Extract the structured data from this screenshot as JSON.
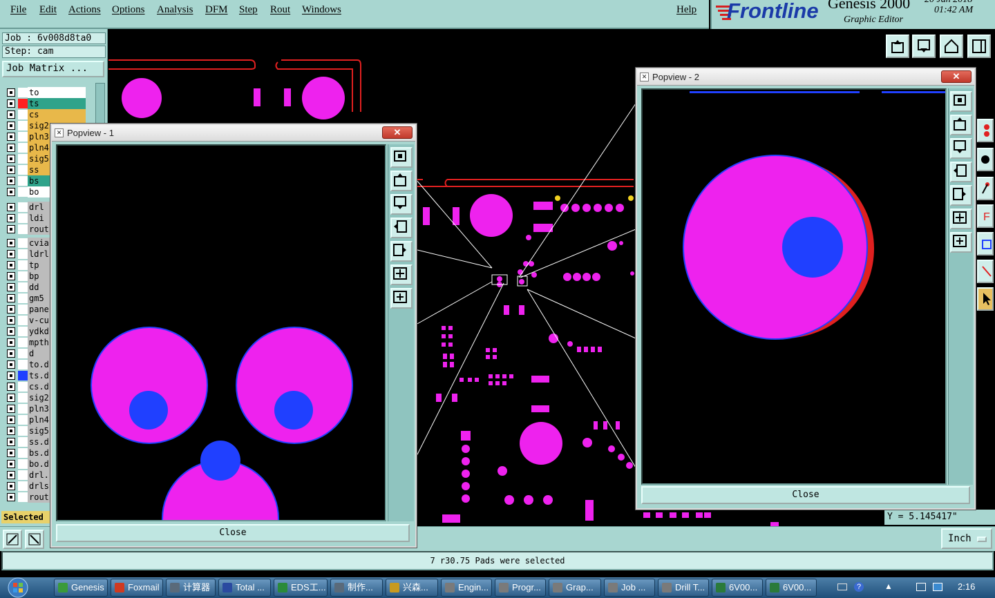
{
  "menu": {
    "items": [
      "File",
      "Edit",
      "Actions",
      "Options",
      "Analysis",
      "DFM",
      "Step",
      "Rout",
      "Windows"
    ],
    "help": "Help"
  },
  "brand": {
    "logo": "Frontline",
    "product": "Genesis 2000",
    "subtitle": "Graphic Editor",
    "date": "20 Jan 2018",
    "time": "01:42 AM"
  },
  "job": {
    "job_label": "Job : 6v008d8ta0",
    "step_label": "Step: cam",
    "matrix_button": "Job Matrix ..."
  },
  "layers": [
    {
      "name": "to",
      "color": "#ffffff",
      "swatch": "#ffffff"
    },
    {
      "name": "ts",
      "color": "#2fa38a",
      "swatch": "#ff2020",
      "active": true
    },
    {
      "name": "cs",
      "color": "#e8b84a",
      "swatch": "#ffffff"
    },
    {
      "name": "sig2",
      "color": "#e8b84a",
      "swatch": "#ffffff"
    },
    {
      "name": "pln3",
      "color": "#e8b84a",
      "swatch": "#ffffff"
    },
    {
      "name": "pln4",
      "color": "#e8b84a",
      "swatch": "#ffffff"
    },
    {
      "name": "sig5",
      "color": "#e8b84a",
      "swatch": "#ffffff"
    },
    {
      "name": "ss",
      "color": "#e8b84a",
      "swatch": "#ffffff"
    },
    {
      "name": "bs",
      "color": "#2fa38a",
      "swatch": "#ffffff"
    },
    {
      "name": "bo",
      "color": "#ffffff",
      "swatch": "#ffffff"
    },
    {
      "name": "drl",
      "color": "#bcbcbc",
      "swatch": "#ffffff"
    },
    {
      "name": "ldi",
      "color": "#bcbcbc",
      "swatch": "#ffffff"
    },
    {
      "name": "rout",
      "color": "#bcbcbc",
      "swatch": "#ffffff"
    },
    {
      "name": "cvia",
      "color": "#bcbcbc",
      "swatch": "#ffffff"
    },
    {
      "name": "ldrl",
      "color": "#bcbcbc",
      "swatch": "#ffffff"
    },
    {
      "name": "tp",
      "color": "#bcbcbc",
      "swatch": "#ffffff"
    },
    {
      "name": "bp",
      "color": "#bcbcbc",
      "swatch": "#ffffff"
    },
    {
      "name": "dd",
      "color": "#bcbcbc",
      "swatch": "#ffffff"
    },
    {
      "name": "gm5",
      "color": "#bcbcbc",
      "swatch": "#ffffff"
    },
    {
      "name": "pane",
      "color": "#bcbcbc",
      "swatch": "#ffffff"
    },
    {
      "name": "v-cu",
      "color": "#bcbcbc",
      "swatch": "#ffffff"
    },
    {
      "name": "ydkd",
      "color": "#bcbcbc",
      "swatch": "#ffffff"
    },
    {
      "name": "mpth",
      "color": "#bcbcbc",
      "swatch": "#ffffff"
    },
    {
      "name": "d",
      "color": "#bcbcbc",
      "swatch": "#ffffff"
    },
    {
      "name": "to.d",
      "color": "#bcbcbc",
      "swatch": "#ffffff"
    },
    {
      "name": "ts.d",
      "color": "#bcbcbc",
      "swatch": "#2040ff"
    },
    {
      "name": "cs.d",
      "color": "#bcbcbc",
      "swatch": "#ffffff"
    },
    {
      "name": "sig2",
      "color": "#bcbcbc",
      "swatch": "#ffffff"
    },
    {
      "name": "pln3",
      "color": "#bcbcbc",
      "swatch": "#ffffff"
    },
    {
      "name": "pln4",
      "color": "#bcbcbc",
      "swatch": "#ffffff"
    },
    {
      "name": "sig5",
      "color": "#bcbcbc",
      "swatch": "#ffffff"
    },
    {
      "name": "ss.d",
      "color": "#bcbcbc",
      "swatch": "#ffffff"
    },
    {
      "name": "bs.d",
      "color": "#bcbcbc",
      "swatch": "#ffffff"
    },
    {
      "name": "bo.d",
      "color": "#bcbcbc",
      "swatch": "#ffffff"
    },
    {
      "name": "drl.",
      "color": "#bcbcbc",
      "swatch": "#ffffff"
    },
    {
      "name": "drls",
      "color": "#bcbcbc",
      "swatch": "#ffffff"
    },
    {
      "name": "rout",
      "color": "#bcbcbc",
      "swatch": "#ffffff"
    }
  ],
  "selected_label": "Selected",
  "popup1": {
    "title": "Popview - 1",
    "close_label": "Close",
    "x_label": "✕"
  },
  "popup2": {
    "title": "Popview - 2",
    "close_label": "Close",
    "x_label": "✕"
  },
  "coords": {
    "y_readout": "Y = 5.145417\""
  },
  "units": {
    "label": "Inch"
  },
  "status": {
    "message": "7 r30.75 Pads were selected"
  },
  "taskbar": {
    "items": [
      {
        "label": "Genesis",
        "icon": "genesis-icon",
        "color": "#3a9a3a"
      },
      {
        "label": "Foxmail",
        "icon": "foxmail-icon",
        "color": "#d03a20"
      },
      {
        "label": "计算器",
        "icon": "calculator-icon",
        "color": "#5a6a7a"
      },
      {
        "label": "Total ...",
        "icon": "total-commander-icon",
        "color": "#2a4aa0"
      },
      {
        "label": "EDS工...",
        "icon": "eds-icon",
        "color": "#2a8a3a"
      },
      {
        "label": "制作...",
        "icon": "document-icon",
        "color": "#5a6a7a"
      },
      {
        "label": "兴森...",
        "icon": "star-icon",
        "color": "#c89a20"
      },
      {
        "label": "Engin...",
        "icon": "x-window-icon",
        "color": "#7a7a7a"
      },
      {
        "label": "Progr...",
        "icon": "x-window-icon",
        "color": "#7a7a7a"
      },
      {
        "label": "Grap...",
        "icon": "x-window-icon",
        "color": "#7a7a7a"
      },
      {
        "label": "Job ...",
        "icon": "x-window-icon",
        "color": "#7a7a7a"
      },
      {
        "label": "Drill T...",
        "icon": "x-window-icon",
        "color": "#7a7a7a"
      },
      {
        "label": "6V00...",
        "icon": "excel-icon",
        "color": "#2a7a3a"
      },
      {
        "label": "6V00...",
        "icon": "excel-icon",
        "color": "#2a7a3a"
      }
    ],
    "clock": "2:16"
  }
}
